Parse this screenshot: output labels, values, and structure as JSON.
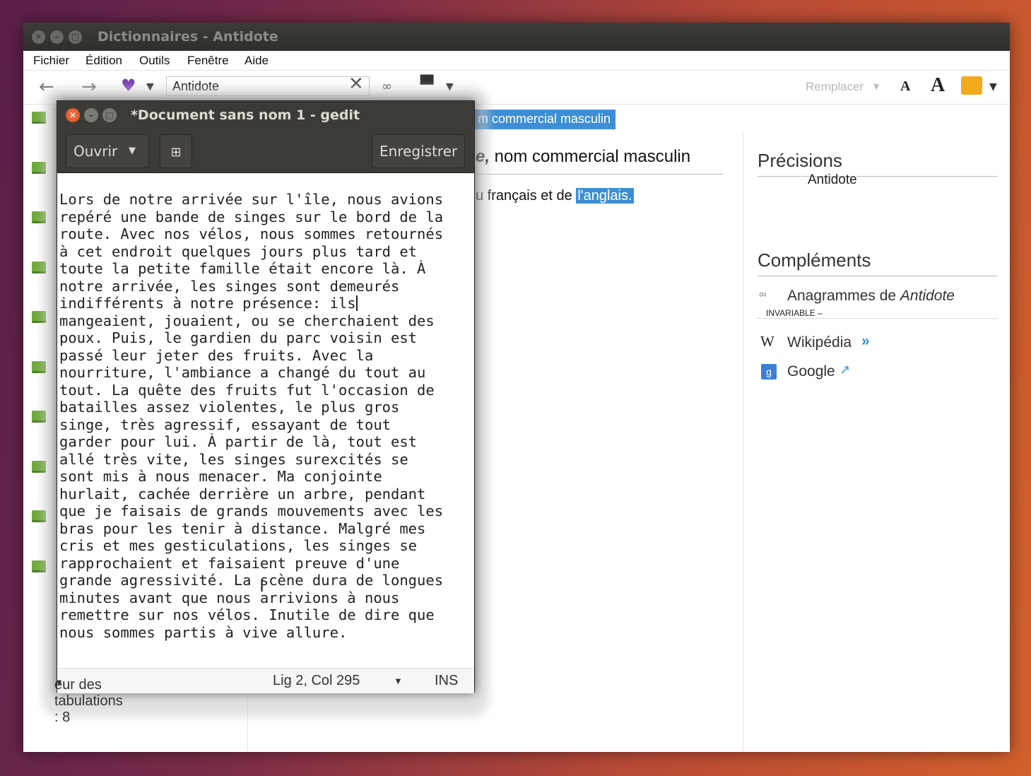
{
  "antidote": {
    "title": "Dictionnaires - Antidote",
    "menu": [
      "Fichier",
      "Édition",
      "Outils",
      "Fenêtre",
      "Aide"
    ],
    "search": {
      "value": "Antidote"
    },
    "toolbar": {
      "replace_label": "Remplacer",
      "font_small": "A",
      "font_large": "A"
    },
    "banner": "m commercial masculin",
    "heading_word": "e,",
    "heading_rest": " nom commercial masculin",
    "definition_prefix": "u français et de ",
    "definition_highlight": "l'anglais.",
    "precisions": {
      "title": "Précisions",
      "tag": "INVARIABLE",
      "dash": " – ",
      "value": "Antidote"
    },
    "complements": {
      "title": "Compléments",
      "anagram_prefix": "Anagrammes de ",
      "anagram_word": "Antidote"
    },
    "links": [
      {
        "label": "Wikipédia",
        "icon": "wikipedia-icon",
        "suffix": "»"
      },
      {
        "label": "Google",
        "icon": "google-icon",
        "suffix": "↗"
      }
    ]
  },
  "gedit": {
    "title": "*Document sans nom 1 - gedit",
    "open_label": "Ouvrir",
    "save_label": "Enregistrer",
    "lines": [
      "Lors de notre arrivée sur l'île, nous avions",
      "repéré une bande de singes sur le bord de la",
      "route. Avec nos vélos, nous sommes retournés",
      "à cet endroit quelques jours plus tard et",
      "toute la petite famille était encore là. À",
      "notre arrivée, les singes sont demeurés",
      "indifférents à notre présence: ils",
      "mangeaient, jouaient, ou se cherchaient des",
      "poux. Puis, le gardien du parc voisin est",
      "passé leur jeter des fruits. Avec la",
      "nourriture, l'ambiance a changé du tout au",
      "tout. La quête des fruits fut l'occasion de",
      "batailles assez violentes, le plus gros",
      "singe, très agressif, essayant de tout",
      "garder pour lui. À partir de là, tout est",
      "allé très vite, les singes surexcités se",
      "sont mis à nous menacer. Ma conjointe",
      "hurlait, cachée derrière un arbre, pendant",
      "que je faisais de grands mouvements avec les",
      "bras pour les tenir à distance. Malgré mes",
      "cris et mes gesticulations, les singes se",
      "rapprochaient et faisaient preuve d'une",
      "grande agressivité. La scène dura de longues",
      "minutes avant que nous arrivions à nous",
      "remettre sur nos vélos. Inutile de dire que",
      "nous sommes partis à vive allure."
    ],
    "status": {
      "tabs": "eur des tabulations : 8",
      "position": "Lig 2, Col 295",
      "mode": "INS"
    }
  }
}
